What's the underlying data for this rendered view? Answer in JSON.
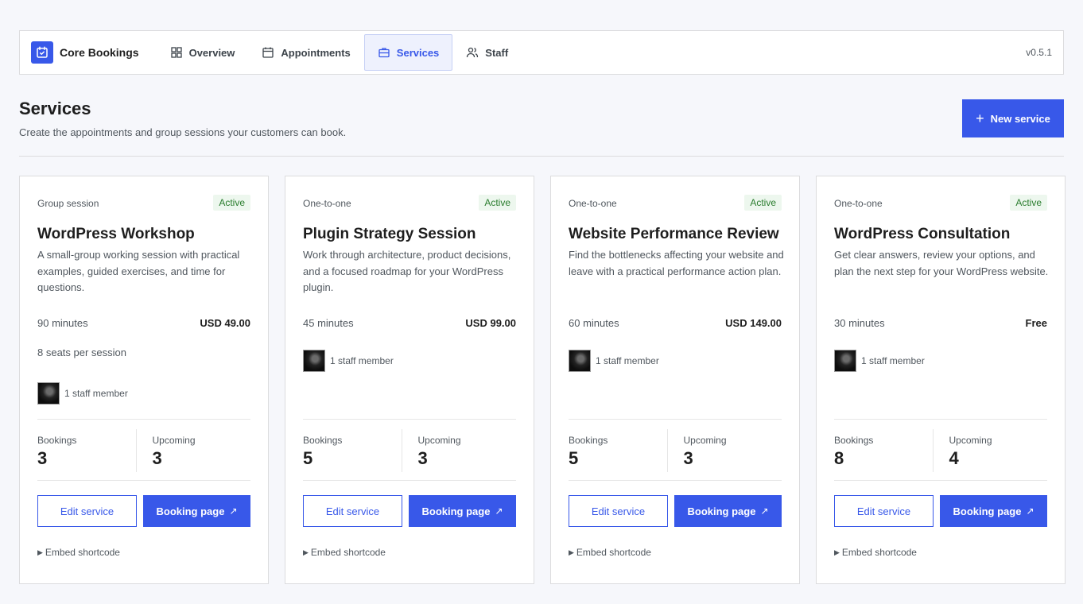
{
  "app": {
    "name": "Core Bookings",
    "version": "v0.5.1"
  },
  "nav": [
    {
      "label": "Overview",
      "icon": "grid-icon",
      "active": false
    },
    {
      "label": "Appointments",
      "icon": "calendar-icon",
      "active": false
    },
    {
      "label": "Services",
      "icon": "briefcase-icon",
      "active": true
    },
    {
      "label": "Staff",
      "icon": "users-icon",
      "active": false
    }
  ],
  "header": {
    "title": "Services",
    "subtitle": "Create the appointments and group sessions your customers can book.",
    "new_button": "New service"
  },
  "labels": {
    "bookings": "Bookings",
    "upcoming": "Upcoming",
    "edit": "Edit service",
    "booking_page": "Booking page",
    "embed": "Embed shortcode"
  },
  "colors": {
    "accent": "#3858e9",
    "active_status": "#2a7d2e"
  },
  "services": [
    {
      "type": "Group session",
      "status": "Active",
      "name": "WordPress Workshop",
      "description": "A small-group working session with practical examples, guided exercises, and time for questions.",
      "duration": "90 minutes",
      "price": "USD 49.00",
      "seats": "8 seats per session",
      "staff": "1 staff member",
      "bookings": "3",
      "upcoming": "3"
    },
    {
      "type": "One-to-one",
      "status": "Active",
      "name": "Plugin Strategy Session",
      "description": "Work through architecture, product decisions, and a focused roadmap for your WordPress plugin.",
      "duration": "45 minutes",
      "price": "USD 99.00",
      "seats": null,
      "staff": "1 staff member",
      "bookings": "5",
      "upcoming": "3"
    },
    {
      "type": "One-to-one",
      "status": "Active",
      "name": "Website Performance Review",
      "description": "Find the bottlenecks affecting your website and leave with a practical performance action plan.",
      "duration": "60 minutes",
      "price": "USD 149.00",
      "seats": null,
      "staff": "1 staff member",
      "bookings": "5",
      "upcoming": "3"
    },
    {
      "type": "One-to-one",
      "status": "Active",
      "name": "WordPress Consultation",
      "description": "Get clear answers, review your options, and plan the next step for your WordPress website.",
      "duration": "30 minutes",
      "price": "Free",
      "seats": null,
      "staff": "1 staff member",
      "bookings": "8",
      "upcoming": "4"
    }
  ]
}
